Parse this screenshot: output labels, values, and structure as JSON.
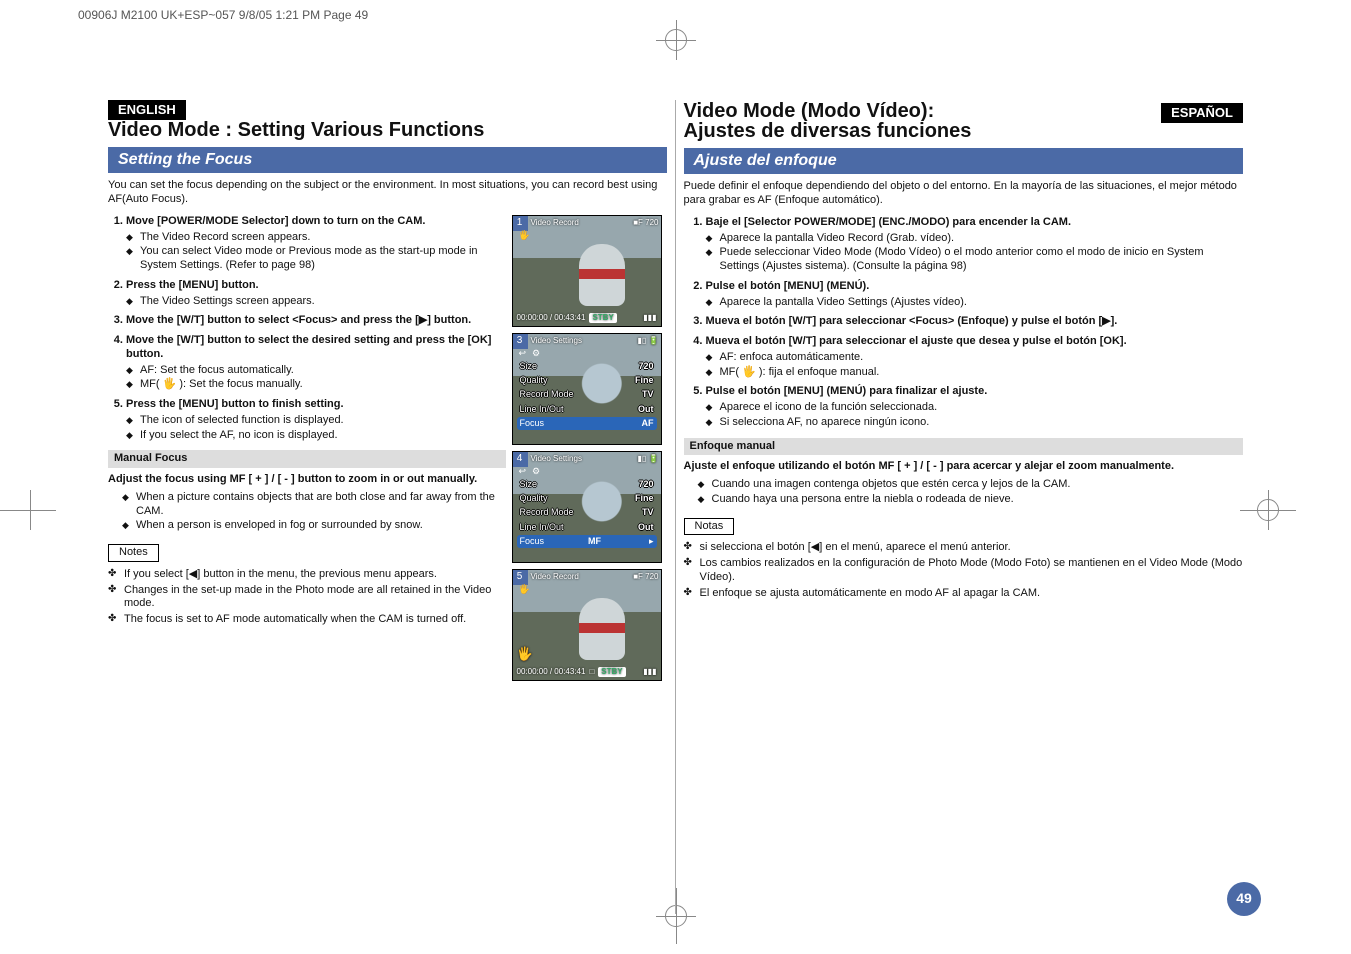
{
  "header_strip": "00906J M2100 UK+ESP~057  9/8/05 1:21 PM  Page 49",
  "left": {
    "lang": "ENGLISH",
    "h1": "Video Mode : Setting Various Functions",
    "h2": "Setting the Focus",
    "intro": "You can set the focus depending on the subject or the environment. In most situations, you can record best using AF(Auto Focus).",
    "steps": [
      {
        "t": "Move [POWER/MODE Selector] down to turn on the CAM.",
        "bullets": [
          "The Video Record screen appears.",
          "You can select Video mode or Previous mode as the start-up mode in System Settings. (Refer to page 98)"
        ]
      },
      {
        "t": "Press the [MENU] button.",
        "bullets": [
          "The Video Settings screen appears."
        ]
      },
      {
        "t": "Move the [W/T] button to select <Focus> and press the [▶] button.",
        "bullets": []
      },
      {
        "t": "Move the [W/T] button to select the desired setting and press the [OK] button.",
        "bullets": [
          "AF: Set the focus automatically.",
          "MF( 🖐 ): Set the focus manually."
        ]
      },
      {
        "t": "Press the [MENU] button to finish setting.",
        "bullets": [
          "The icon of selected function is displayed.",
          "If you select the AF, no icon is displayed."
        ]
      }
    ],
    "manual_h": "Manual Focus",
    "manual_line": "Adjust the focus using MF [ + ] / [ - ] button to zoom in or out manually.",
    "manual_bullets": [
      "When a picture contains objects that are both close and far away from the CAM.",
      "When a person is enveloped in fog or surrounded by snow."
    ],
    "notes_label": "Notes",
    "notes": [
      "If you select [◀] button in the menu, the previous menu appears.",
      "Changes in the set-up made in the Photo mode are all retained in the Video mode.",
      "The focus is set to AF mode automatically when the CAM is turned off."
    ]
  },
  "right": {
    "lang": "ESPAÑOL",
    "h1a": "Video Mode (Modo Vídeo):",
    "h1b": "Ajustes de diversas funciones",
    "h2": "Ajuste del enfoque",
    "intro": "Puede definir el enfoque dependiendo del objeto o del entorno. En la mayoría de las situaciones, el mejor método para grabar es AF (Enfoque automático).",
    "steps": [
      {
        "t": "Baje el [Selector POWER/MODE] (ENC./MODO) para encender la CAM.",
        "bullets": [
          "Aparece la pantalla Video Record (Grab. vídeo).",
          "Puede seleccionar Video Mode (Modo Vídeo) o el modo anterior como el modo de inicio en System Settings (Ajustes sistema). (Consulte la página 98)"
        ]
      },
      {
        "t": "Pulse el botón [MENU] (MENÚ).",
        "bullets": [
          "Aparece la pantalla Video Settings (Ajustes vídeo)."
        ]
      },
      {
        "t": "Mueva el botón [W/T] para seleccionar <Focus> (Enfoque) y pulse el botón [▶].",
        "bullets": []
      },
      {
        "t": "Mueva el botón [W/T] para seleccionar el ajuste que desea y pulse el botón [OK].",
        "bullets": [
          "AF: enfoca automáticamente.",
          "MF( 🖐 ): fija el enfoque manual."
        ]
      },
      {
        "t": "Pulse el botón [MENU] (MENÚ) para finalizar el ajuste.",
        "bullets": [
          "Aparece el icono de la función seleccionada.",
          "Si selecciona AF, no aparece ningún icono."
        ]
      }
    ],
    "manual_h": "Enfoque manual",
    "manual_line": "Ajuste el enfoque utilizando el botón MF [ + ] / [ - ] para acercar y alejar el zoom manualmente.",
    "manual_bullets": [
      "Cuando una imagen contenga objetos que estén cerca y lejos de la CAM.",
      "Cuando haya una persona entre la niebla o rodeada de nieve."
    ],
    "notes_label": "Notas",
    "notes": [
      "si selecciona el botón [◀] en el menú, aparece el menú anterior.",
      "Los cambios realizados en la configuración de Photo Mode (Modo Foto) se mantienen en el Video Mode (Modo Vídeo).",
      "El enfoque se ajusta automáticamente en modo AF al apagar la CAM."
    ],
    "page_num": "49"
  },
  "shots": {
    "s1": {
      "num": "1",
      "title_left": "Video Record",
      "title_right": "■F  720",
      "bottom_left": "00:00:00 / 00:43:41",
      "stby": "STBY"
    },
    "s3": {
      "num": "3",
      "title": "Video Settings",
      "rows": [
        {
          "k": "Size",
          "v": "720"
        },
        {
          "k": "Quality",
          "v": "Fine"
        },
        {
          "k": "Record Mode",
          "v": "TV"
        },
        {
          "k": "Line In/Out",
          "v": "Out"
        },
        {
          "k": "Focus",
          "v": "AF",
          "hl": true
        }
      ]
    },
    "s4": {
      "num": "4",
      "title": "Video Settings",
      "rows": [
        {
          "k": "Size",
          "v": "720"
        },
        {
          "k": "Quality",
          "v": "Fine"
        },
        {
          "k": "Record Mode",
          "v": "TV"
        },
        {
          "k": "Line In/Out",
          "v": "Out"
        },
        {
          "k": "Focus",
          "v": "MF",
          "hl": true
        }
      ]
    },
    "s5": {
      "num": "5",
      "title_left": "Video Record",
      "title_right": "■F  720",
      "bottom_left": "00:00:00 / 00:43:41",
      "stby": "STBY",
      "mf_icon": "🖐"
    }
  }
}
